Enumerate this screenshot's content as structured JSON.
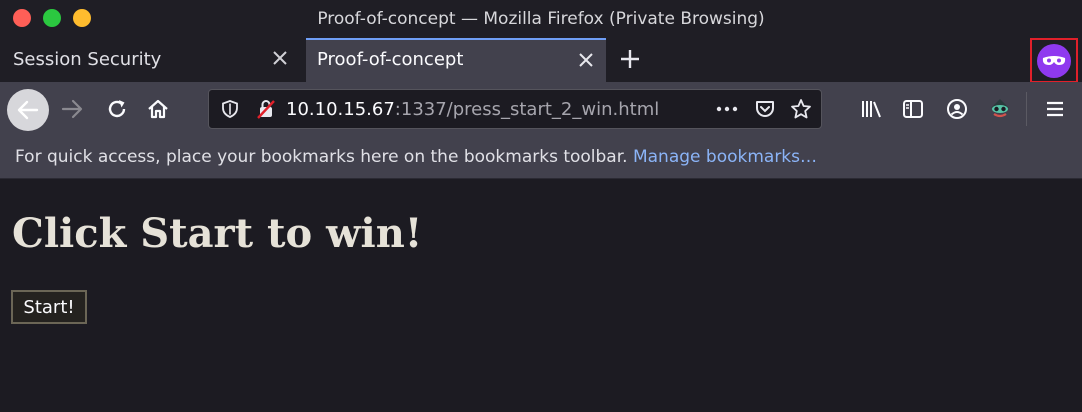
{
  "window": {
    "title": "Proof-of-concept — Mozilla Firefox (Private Browsing)"
  },
  "tabs": [
    {
      "label": "Session Security",
      "active": false
    },
    {
      "label": "Proof-of-concept",
      "active": true
    }
  ],
  "navbar": {
    "url_host": "10.10.15.67",
    "url_rest": ":1337/press_start_2_win.html",
    "icons": [
      "back-icon",
      "forward-icon",
      "reload-icon",
      "home-icon",
      "shield-icon",
      "insecure-lock-icon",
      "more-icon",
      "pocket-icon",
      "bookmark-star-icon",
      "library-icon",
      "sidebar-icon",
      "account-icon",
      "extension-icon",
      "menu-icon"
    ]
  },
  "bookmarks_bar": {
    "message": "For quick access, place your bookmarks here on the bookmarks toolbar. ",
    "link": "Manage bookmarks…"
  },
  "page": {
    "heading": "Click Start to win!",
    "start_button": "Start!"
  },
  "colors": {
    "accent": "#6f9ef5",
    "private": "#8f39ef",
    "highlight_box": "#e0202a"
  }
}
